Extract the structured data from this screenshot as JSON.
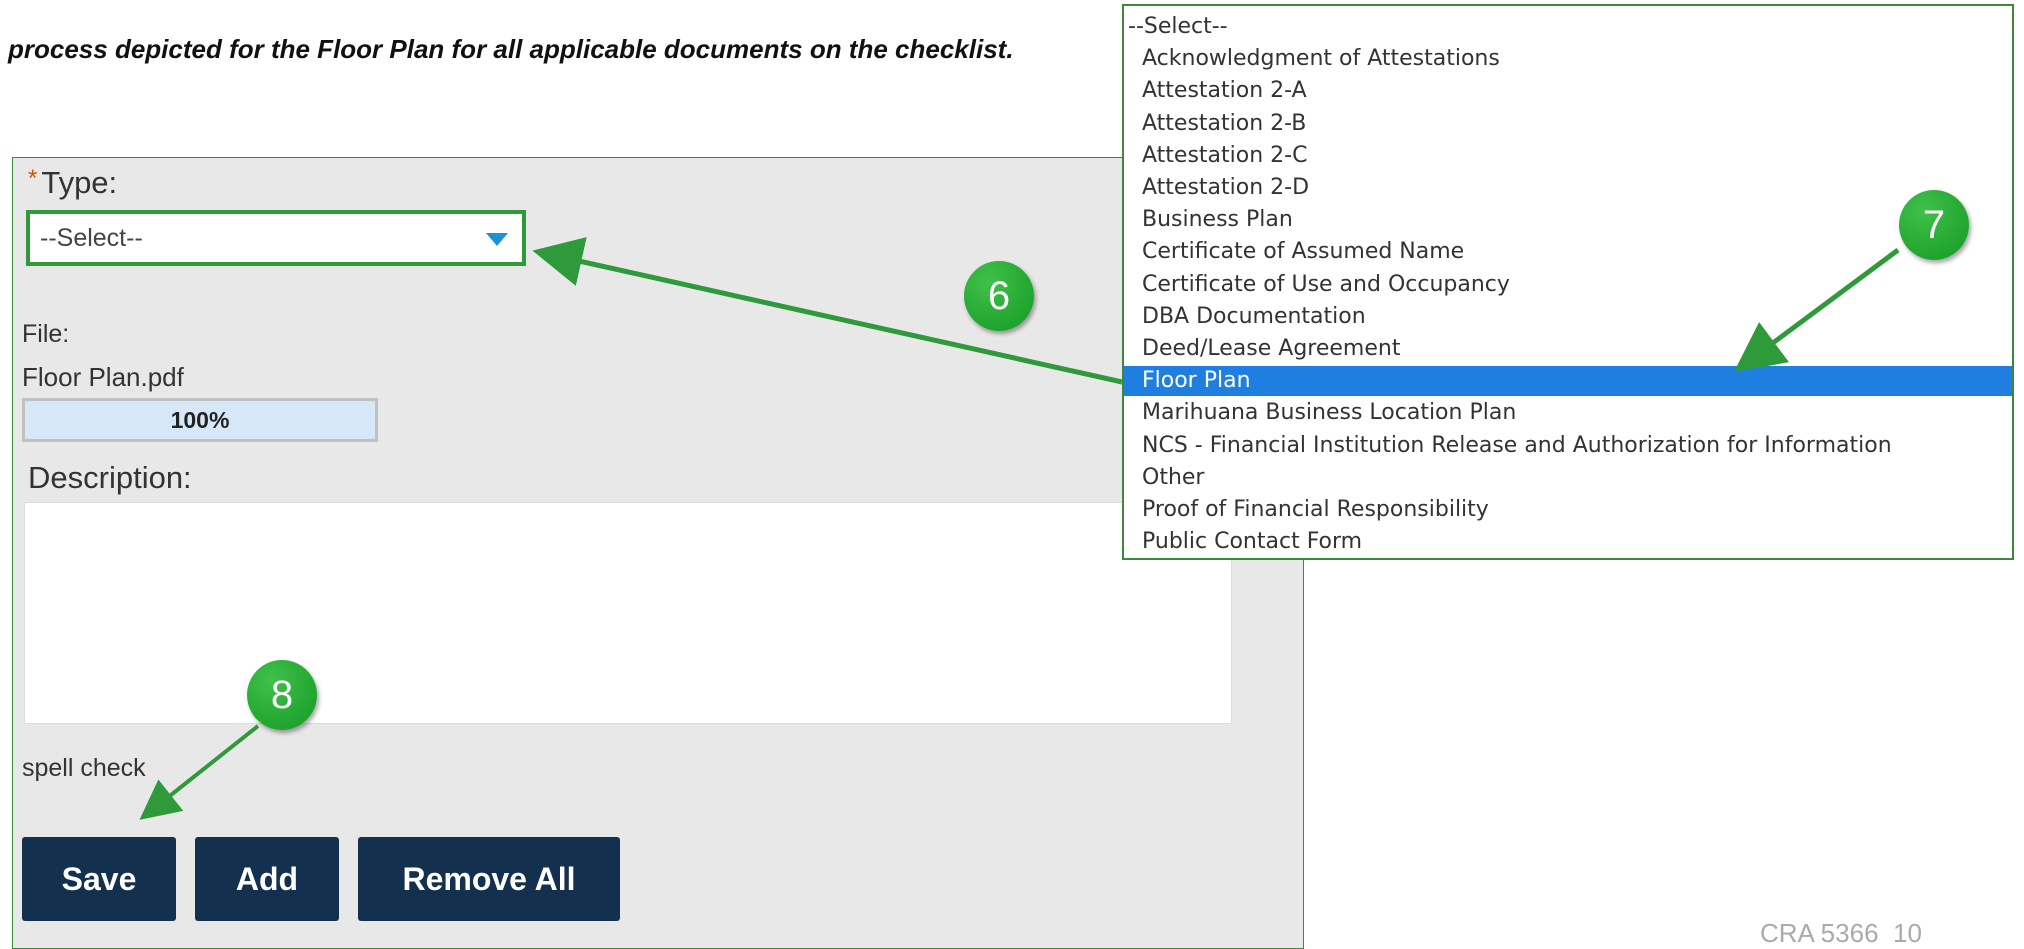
{
  "instruction": "process depicted for the Floor Plan for all applicable documents on the checklist.",
  "form": {
    "required_marker": "*",
    "type_label": "Type:",
    "type_value": "--Select--",
    "file_label": "File:",
    "file_name": "Floor Plan.pdf",
    "upload_progress_text": "100%",
    "upload_progress": 1.0,
    "description_label": "Description:",
    "description_value": "",
    "spell_check": "spell check",
    "buttons": {
      "save": "Save",
      "add": "Add",
      "remove_all": "Remove All"
    }
  },
  "dropdown": {
    "options": [
      "--Select--",
      "Acknowledgment of Attestations",
      "Attestation 2-A",
      "Attestation 2-B",
      "Attestation 2-C",
      "Attestation 2-D",
      "Business Plan",
      "Certificate of Assumed Name",
      "Certificate of Use and Occupancy",
      "DBA Documentation",
      "Deed/Lease Agreement",
      "Floor Plan",
      "Marihuana Business Location Plan",
      "NCS - Financial Institution Release and Authorization for Information",
      "Other",
      "Proof of Financial Responsibility",
      "Public Contact Form"
    ],
    "selected_index": 11
  },
  "callouts": [
    "6",
    "7",
    "8"
  ],
  "footer": {
    "doc_code": "CRA 5366",
    "page_number": "10"
  },
  "colors": {
    "accent_green": "#2e9a3a",
    "button_navy": "#14304f",
    "selected_blue": "#1e7fe0"
  }
}
